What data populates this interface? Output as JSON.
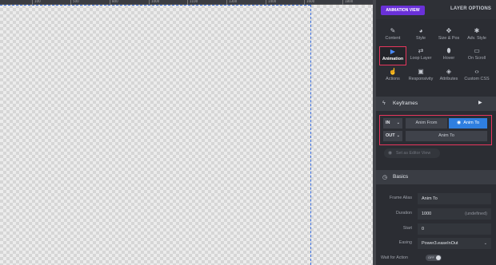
{
  "ruler": {
    "ticks": [
      "100",
      "500",
      "800",
      "1000",
      "1100",
      "1300",
      "1400",
      "1600",
      "1800"
    ]
  },
  "panel": {
    "animation_view_label": "ANIMATION VIEW",
    "layer_options_label": "LAYER OPTIONS",
    "tools": [
      {
        "label": "Content",
        "icon": "pencil-icon"
      },
      {
        "label": "Style",
        "icon": "palette-icon"
      },
      {
        "label": "Size & Pos",
        "icon": "move-icon"
      },
      {
        "label": "Adv. Style",
        "icon": "gear-icon"
      },
      {
        "label": "Animation",
        "icon": "play-icon",
        "active": true
      },
      {
        "label": "Loop Layer",
        "icon": "loop-icon"
      },
      {
        "label": "Hover",
        "icon": "mouse-icon"
      },
      {
        "label": "On Scroll",
        "icon": "scroll-icon"
      },
      {
        "label": "Actions",
        "icon": "hand-icon"
      },
      {
        "label": "Responsivity",
        "icon": "devices-icon"
      },
      {
        "label": "Attributes",
        "icon": "tag-icon"
      },
      {
        "label": "Custom CSS",
        "icon": "code-icon"
      }
    ]
  },
  "keyframes": {
    "title": "Keyframes",
    "in_label": "IN",
    "out_label": "OUT",
    "anim_from": "Anim From",
    "anim_to": "Anim To",
    "out_anim_to": "Anim To",
    "set_editor_view": "Set as Editor View"
  },
  "basics": {
    "title": "Basics",
    "fields": {
      "frame_alias": {
        "label": "Frame Alias",
        "value": "Anim To"
      },
      "duration": {
        "label": "Duration",
        "value": "1000",
        "hint": "(undefined)"
      },
      "start": {
        "label": "Start",
        "value": "0"
      },
      "easing": {
        "label": "Easing",
        "value": "Power3.easeInOut"
      }
    },
    "wait_for_action": {
      "label": "Wait for Action",
      "toggle": "OFF"
    }
  },
  "colors": {
    "accent_purple": "#6a31d8",
    "active_blue": "#2f7fe0",
    "highlight_red": "#e8365d",
    "guide_blue": "#3b6fe0"
  }
}
